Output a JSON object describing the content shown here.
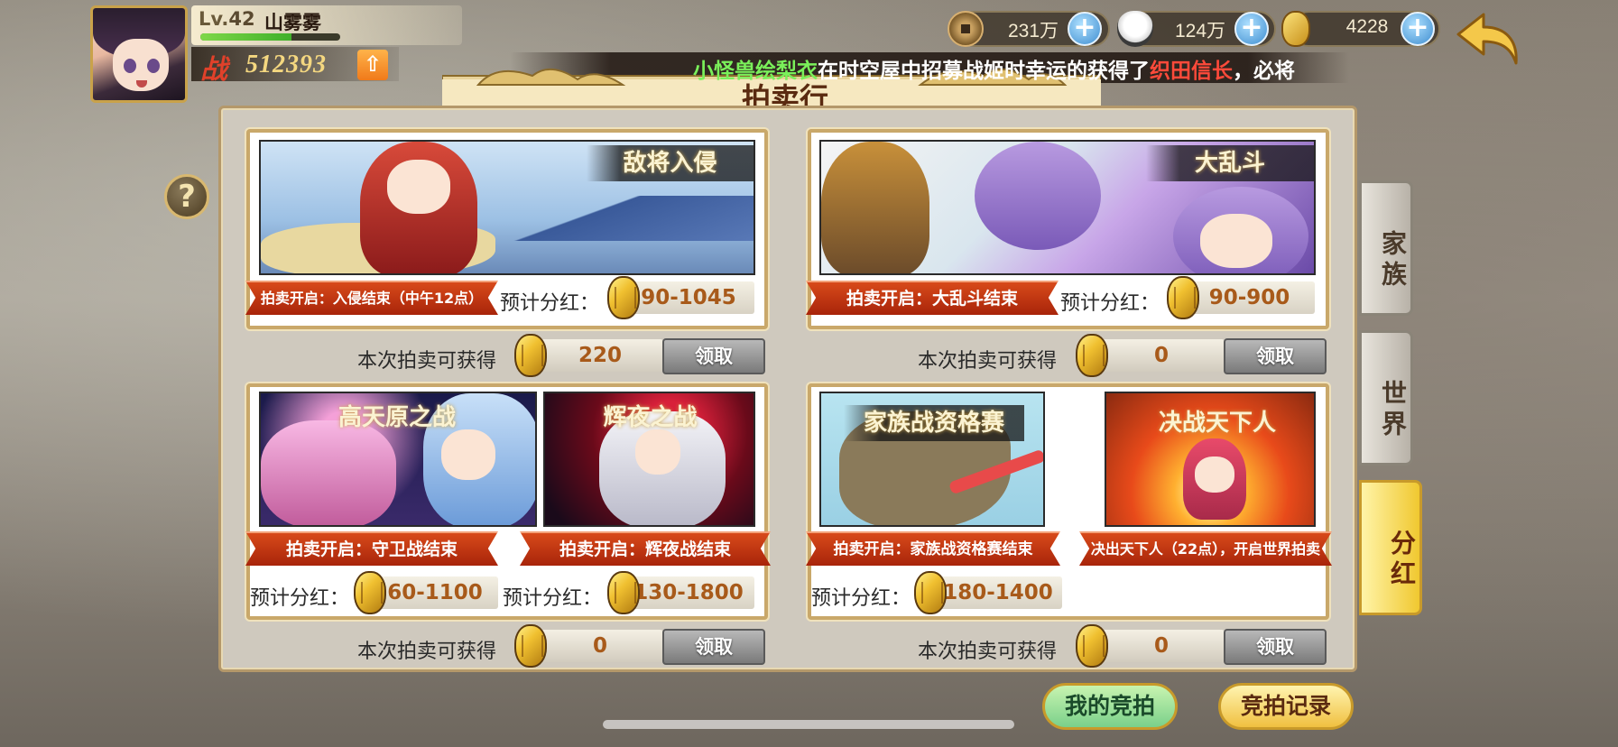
{
  "player": {
    "level_prefix": "Lv.",
    "level": "42",
    "name": "山雾雾",
    "exp_fraction": 0.65,
    "power_label": "战",
    "power_value": "512393"
  },
  "currencies": [
    {
      "name": "copper-coin",
      "value": "231万"
    },
    {
      "name": "rice-ball",
      "value": "124万"
    },
    {
      "name": "gold-coin",
      "value": "4228"
    }
  ],
  "ticker": {
    "player_name": "小怪兽绘梨衣",
    "middle": "在时空屋中招募战姬时幸运的获得了",
    "item": "织田信长",
    "tail": "，必将"
  },
  "title": "拍卖行",
  "auctions": {
    "invasion": {
      "title": "敌将入侵",
      "open_condition": "拍卖开启：入侵结束（中午12点）",
      "est_label": "预计分红：",
      "est_value": "90-1045",
      "earn_label": "本次拍卖可获得",
      "earn_value": "220",
      "claim": "领取"
    },
    "brawl": {
      "title": "大乱斗",
      "open_condition": "拍卖开启：大乱斗结束",
      "est_label": "预计分红：",
      "est_value": "90-900",
      "earn_label": "本次拍卖可获得",
      "earn_value": "0",
      "claim": "领取"
    },
    "takamagahara": {
      "title": "高天原之战",
      "open_condition": "拍卖开启：守卫战结束",
      "est_label": "预计分红：",
      "est_value": "60-1100"
    },
    "kaguya": {
      "title": "辉夜之战",
      "open_condition": "拍卖开启：辉夜战结束",
      "est_label": "预计分红：",
      "est_value": "130-1800"
    },
    "family_qual": {
      "title": "家族战资格赛",
      "open_condition": "拍卖开启：家族战资格赛结束",
      "est_label": "预计分红：",
      "est_value": "180-1400"
    },
    "decisive": {
      "title": "决战天下人",
      "open_condition": "决出天下人（22点），开启世界拍卖"
    },
    "row2_left": {
      "earn_label": "本次拍卖可获得",
      "earn_value": "0",
      "claim": "领取"
    },
    "row2_right": {
      "earn_label": "本次拍卖可获得",
      "earn_value": "0",
      "claim": "领取"
    }
  },
  "tabs": {
    "family": "家族",
    "world": "世界",
    "dividend": "分红"
  },
  "help": "?",
  "buttons": {
    "my_bids": "我的竞拍",
    "bid_record": "竞拍记录"
  }
}
